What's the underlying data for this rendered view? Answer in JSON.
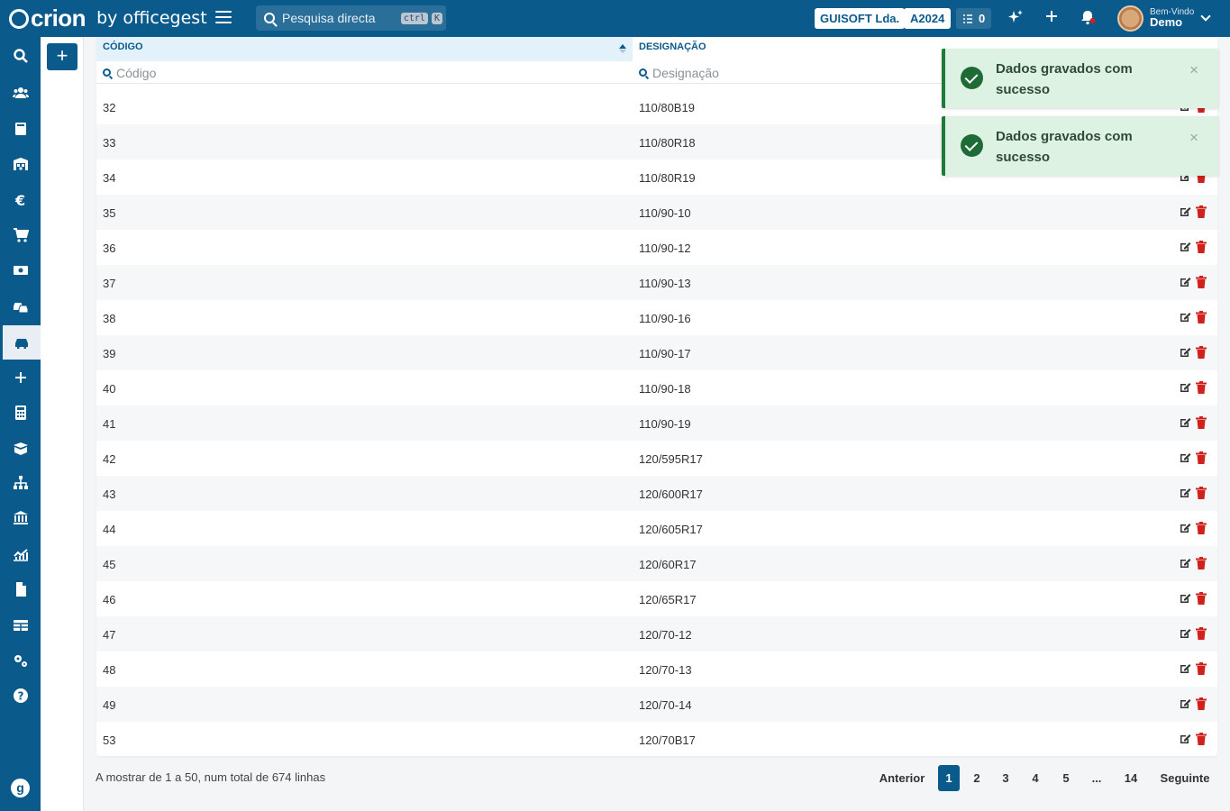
{
  "header": {
    "logo_text": "crion",
    "logo_by": "by officegest",
    "search_placeholder": "Pesquisa directa",
    "shortcut_key1": "ctrl",
    "shortcut_key2": "K",
    "company": "GUISOFT Lda.",
    "year": "A2024",
    "tasks_count": "0",
    "welcome_label": "Bem-Vindo",
    "user_name": "Demo"
  },
  "sidebar": {
    "items": [
      "search",
      "users",
      "book",
      "warehouse",
      "euro",
      "cart",
      "money",
      "cars",
      "car",
      "plus",
      "calculator",
      "box",
      "sitemap",
      "bank",
      "chart",
      "document",
      "table",
      "cogs",
      "help"
    ],
    "active": "car",
    "bottom_logo": "g"
  },
  "table": {
    "columns": [
      {
        "label": "CÓDIGO",
        "filter_placeholder": "Código"
      },
      {
        "label": "DESIGNAÇÃO",
        "filter_placeholder": "Designação"
      }
    ],
    "rows": [
      {
        "code": "32",
        "designation": "110/80B19"
      },
      {
        "code": "33",
        "designation": "110/80R18"
      },
      {
        "code": "34",
        "designation": "110/80R19"
      },
      {
        "code": "35",
        "designation": "110/90-10"
      },
      {
        "code": "36",
        "designation": "110/90-12"
      },
      {
        "code": "37",
        "designation": "110/90-13"
      },
      {
        "code": "38",
        "designation": "110/90-16"
      },
      {
        "code": "39",
        "designation": "110/90-17"
      },
      {
        "code": "40",
        "designation": "110/90-18"
      },
      {
        "code": "41",
        "designation": "110/90-19"
      },
      {
        "code": "42",
        "designation": "120/595R17"
      },
      {
        "code": "43",
        "designation": "120/600R17"
      },
      {
        "code": "44",
        "designation": "120/605R17"
      },
      {
        "code": "45",
        "designation": "120/60R17"
      },
      {
        "code": "46",
        "designation": "120/65R17"
      },
      {
        "code": "47",
        "designation": "120/70-12"
      },
      {
        "code": "48",
        "designation": "120/70-13"
      },
      {
        "code": "49",
        "designation": "120/70-14"
      },
      {
        "code": "53",
        "designation": "120/70B17"
      }
    ]
  },
  "footer": {
    "info": "A mostrar de 1 a 50, num total de 674 linhas",
    "prev": "Anterior",
    "pages": [
      "1",
      "2",
      "3",
      "4",
      "5",
      "...",
      "14"
    ],
    "current_page": "1",
    "next": "Seguinte"
  },
  "toasts": [
    {
      "message": "Dados gravados com sucesso",
      "close": "×"
    },
    {
      "message": "Dados gravados com sucesso",
      "close": "×"
    }
  ],
  "colors": {
    "primary": "#0b5a8c",
    "delete": "#d0211c",
    "success_bg": "#def2e3",
    "success_icon": "#1f6b35"
  }
}
